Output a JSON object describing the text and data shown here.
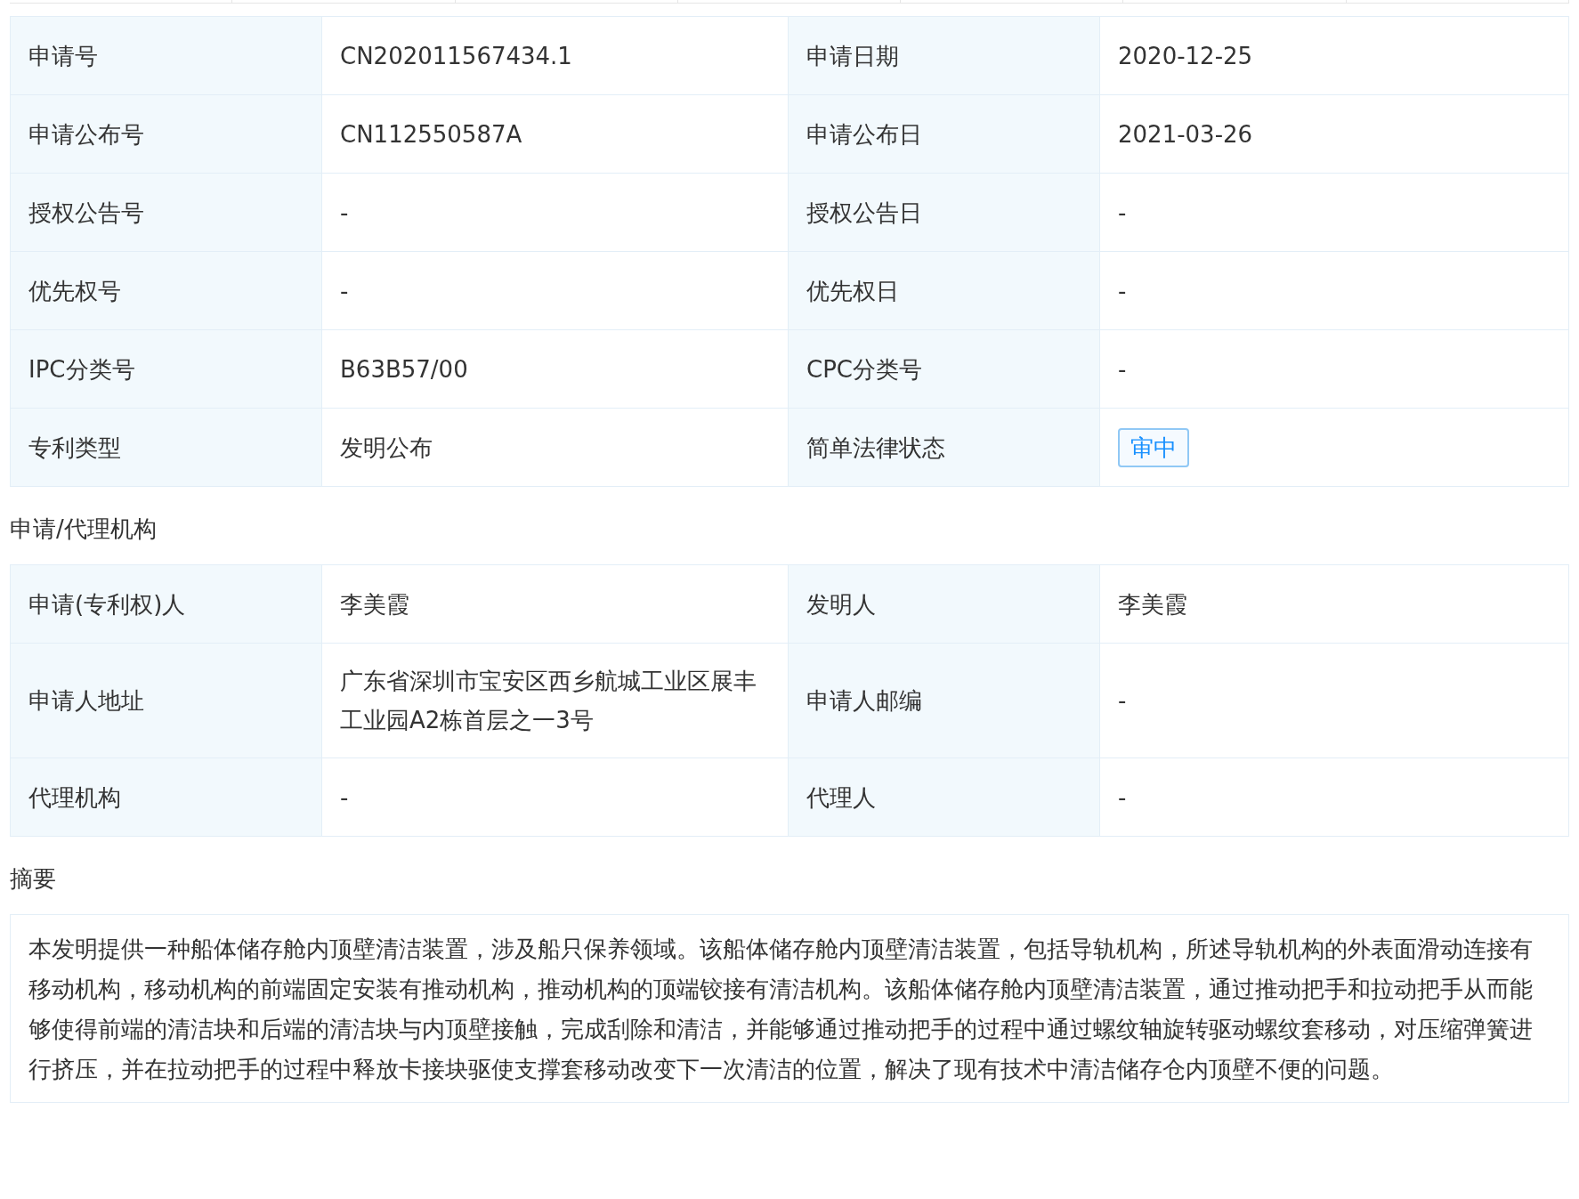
{
  "basic_info": {
    "rows": [
      {
        "cells": [
          {
            "label": "申请号",
            "value": "CN202011567434.1"
          },
          {
            "label": "申请日期",
            "value": "2020-12-25"
          }
        ]
      },
      {
        "cells": [
          {
            "label": "申请公布号",
            "value": "CN112550587A"
          },
          {
            "label": "申请公布日",
            "value": "2021-03-26"
          }
        ]
      },
      {
        "cells": [
          {
            "label": "授权公告号",
            "value": "-"
          },
          {
            "label": "授权公告日",
            "value": "-"
          }
        ]
      },
      {
        "cells": [
          {
            "label": "优先权号",
            "value": "-"
          },
          {
            "label": "优先权日",
            "value": "-"
          }
        ]
      },
      {
        "cells": [
          {
            "label": "IPC分类号",
            "value": "B63B57/00"
          },
          {
            "label": "CPC分类号",
            "value": "-"
          }
        ]
      },
      {
        "cells": [
          {
            "label": "专利类型",
            "value": "发明公布"
          },
          {
            "label": "简单法律状态",
            "value": "审中",
            "kind": "badge"
          }
        ]
      }
    ]
  },
  "applicant_section": {
    "title": "申请/代理机构",
    "rows": [
      {
        "cells": [
          {
            "label": "申请(专利权)人",
            "value": "李美霞"
          },
          {
            "label": "发明人",
            "value": "李美霞"
          }
        ]
      },
      {
        "cells": [
          {
            "label": "申请人地址",
            "value": "广东省深圳市宝安区西乡航城工业区展丰工业园A2栋首层之一3号"
          },
          {
            "label": "申请人邮编",
            "value": "-"
          }
        ]
      },
      {
        "cells": [
          {
            "label": "代理机构",
            "value": "-"
          },
          {
            "label": "代理人",
            "value": "-"
          }
        ]
      }
    ]
  },
  "abstract": {
    "title": "摘要",
    "text": "本发明提供一种船体储存舱内顶壁清洁装置，涉及船只保养领域。该船体储存舱内顶壁清洁装置，包括导轨机构，所述导轨机构的外表面滑动连接有移动机构，移动机构的前端固定安装有推动机构，推动机构的顶端铰接有清洁机构。该船体储存舱内顶壁清洁装置，通过推动把手和拉动把手从而能够使得前端的清洁块和后端的清洁块与内顶壁接触，完成刮除和清洁，并能够通过推动把手的过程中通过螺纹轴旋转驱动螺纹套移动，对压缩弹簧进行挤压，并在拉动把手的过程中释放卡接块驱使支撑套移动改变下一次清洁的位置，解决了现有技术中清洁储存仓内顶壁不便的问题。"
  }
}
